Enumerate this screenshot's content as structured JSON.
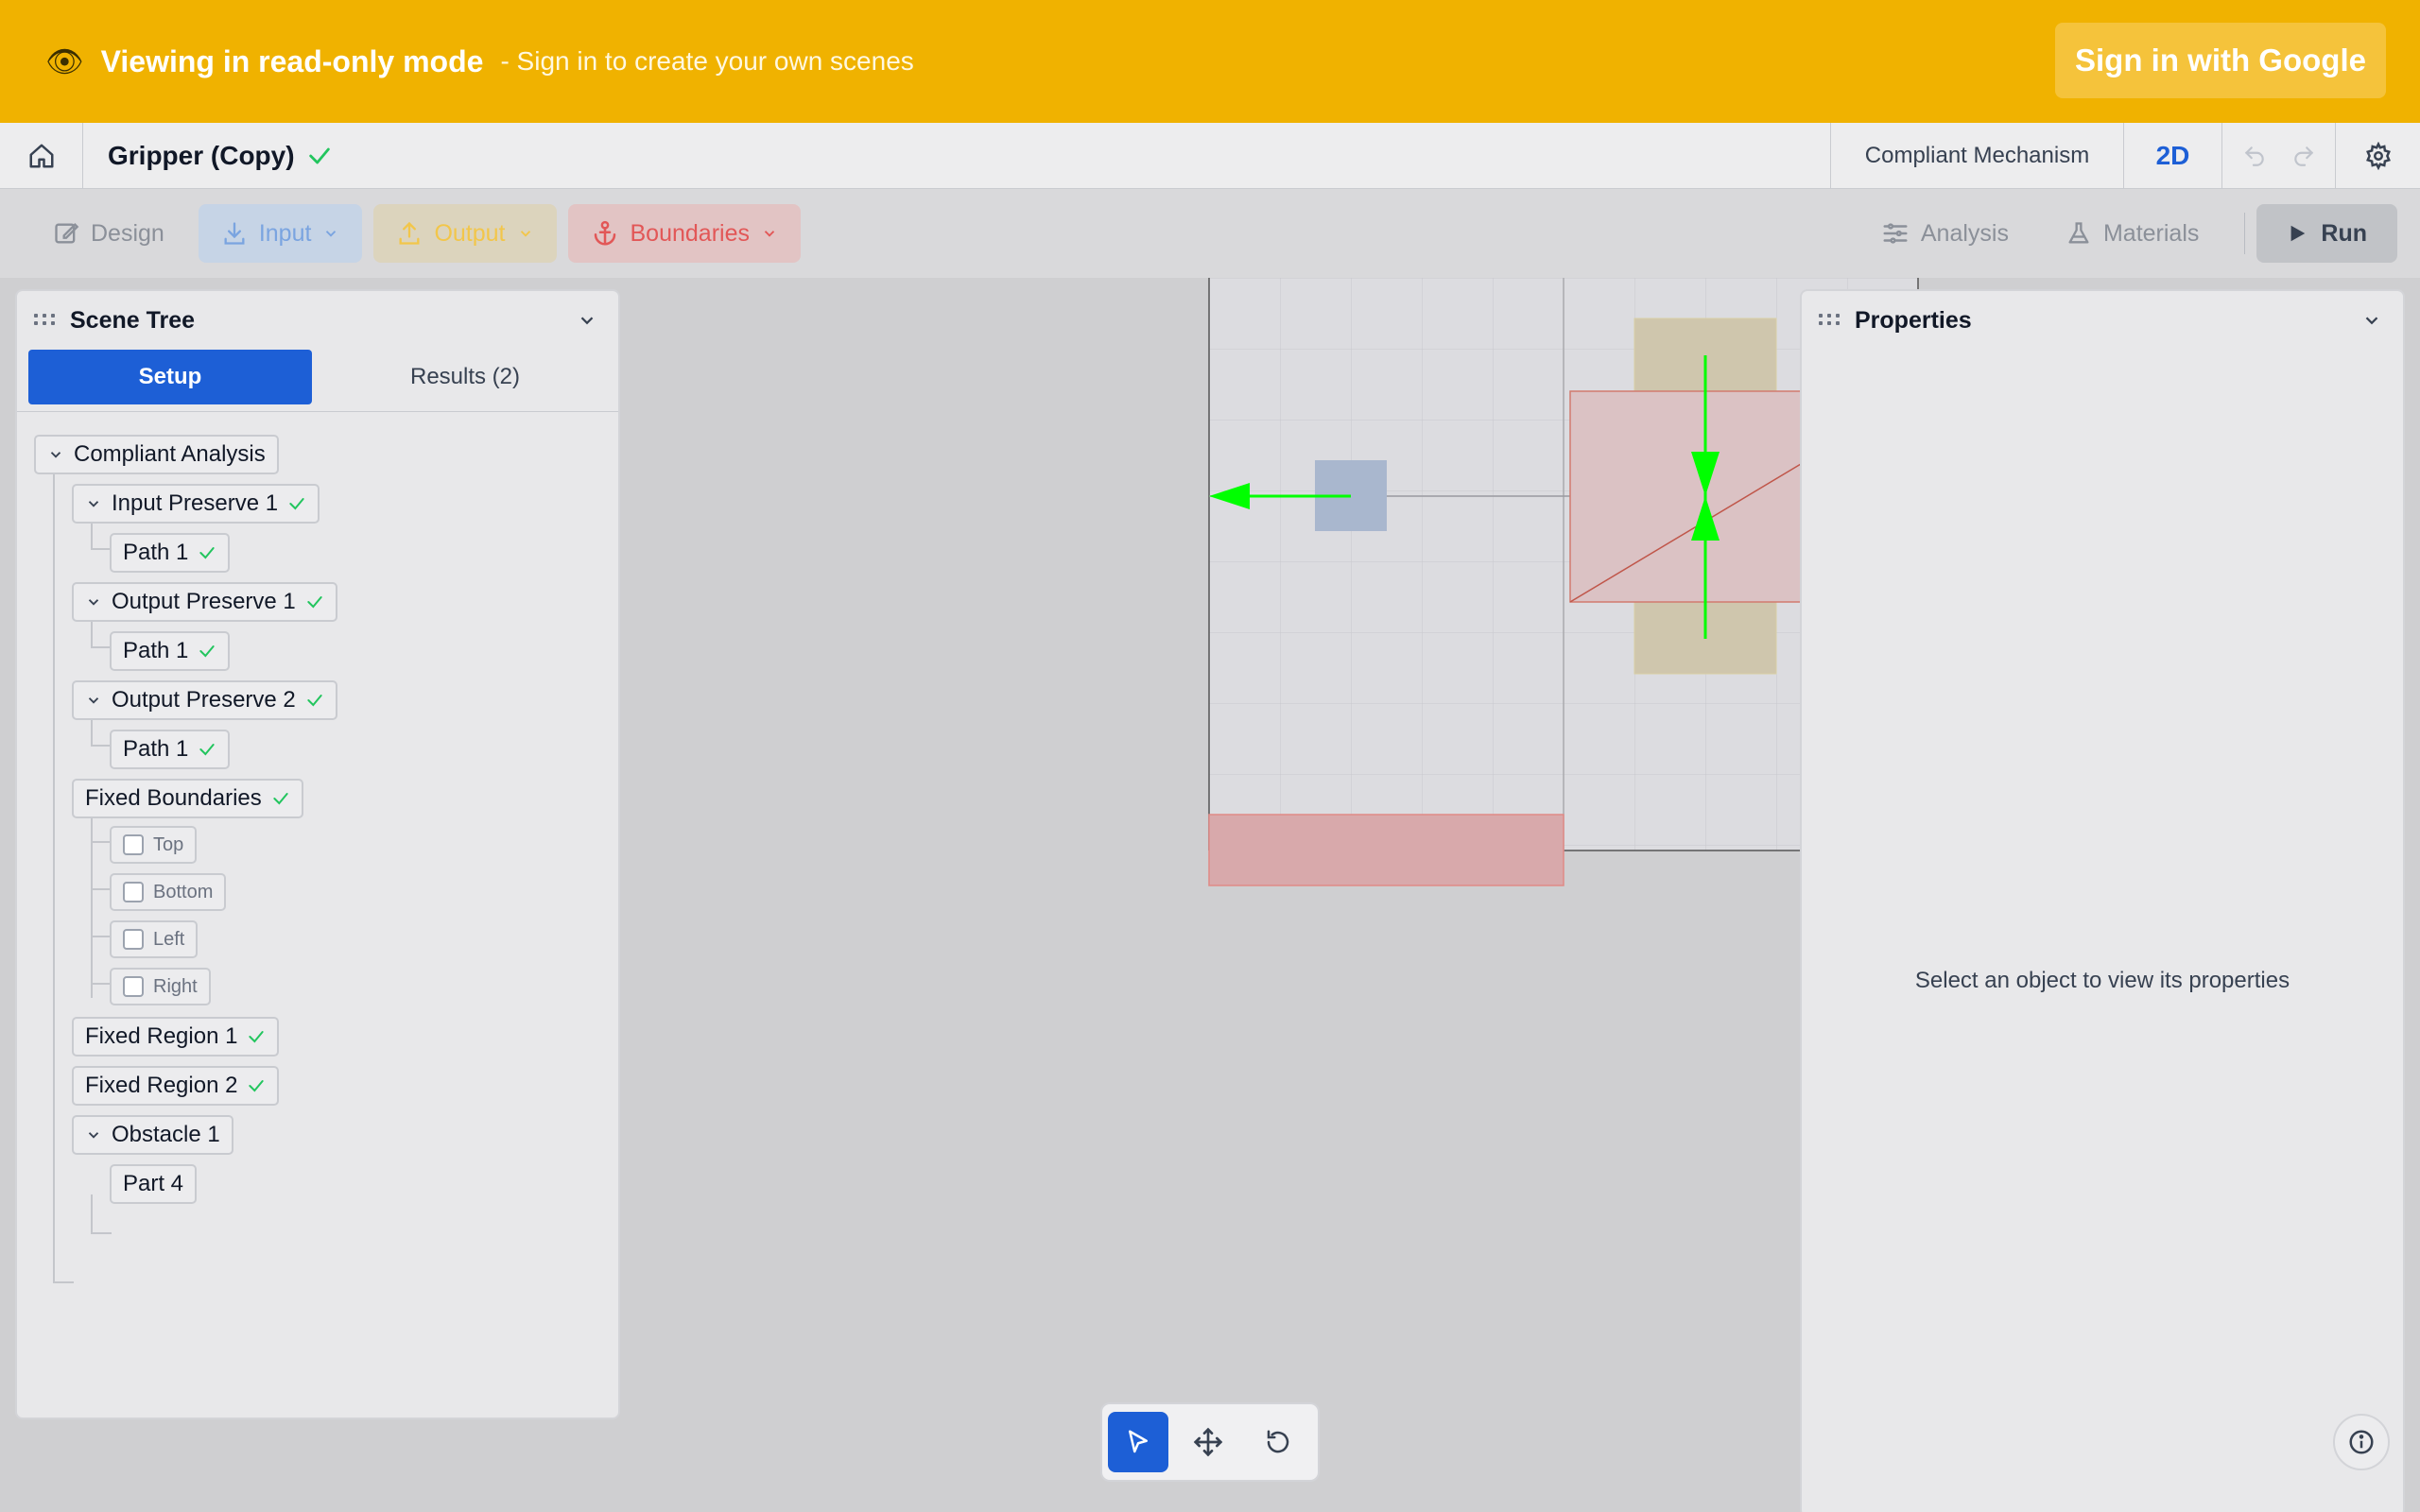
{
  "banner": {
    "eye_glyph": "👁",
    "message": "Viewing in read-only mode",
    "sub": "- Sign in to create your own scenes",
    "signin_label": "Sign in with Google",
    "color": "#f0b200"
  },
  "header": {
    "title": "Gripper (Copy)",
    "mode": "Compliant Mechanism",
    "view": "2D"
  },
  "toolbar": {
    "design": "Design",
    "input": "Input",
    "output": "Output",
    "boundaries": "Boundaries",
    "analysis": "Analysis",
    "materials": "Materials",
    "run": "Run"
  },
  "scene_tree": {
    "title": "Scene Tree",
    "tabs": [
      "Setup",
      "Results (2)"
    ],
    "nodes": {
      "root": "Compliant Analysis",
      "input_preserve_1": "Input Preserve 1",
      "input_path_1": "Path 1",
      "output_preserve_1": "Output Preserve 1",
      "output1_path_1": "Path 1",
      "output_preserve_2": "Output Preserve 2",
      "output2_path_1": "Path 1",
      "fixed_boundaries": "Fixed Boundaries",
      "top": "Top",
      "bottom": "Bottom",
      "left": "Left",
      "right": "Right",
      "fixed_region_1": "Fixed Region 1",
      "fixed_region_2": "Fixed Region 2",
      "obstacle_1": "Obstacle 1",
      "part_4": "Part 4"
    }
  },
  "properties": {
    "title": "Properties",
    "empty_message": "Select an object to view its properties"
  },
  "colors": {
    "accent": "#1d5fd6",
    "check": "#22c55e",
    "arrow": "#00ff00"
  }
}
